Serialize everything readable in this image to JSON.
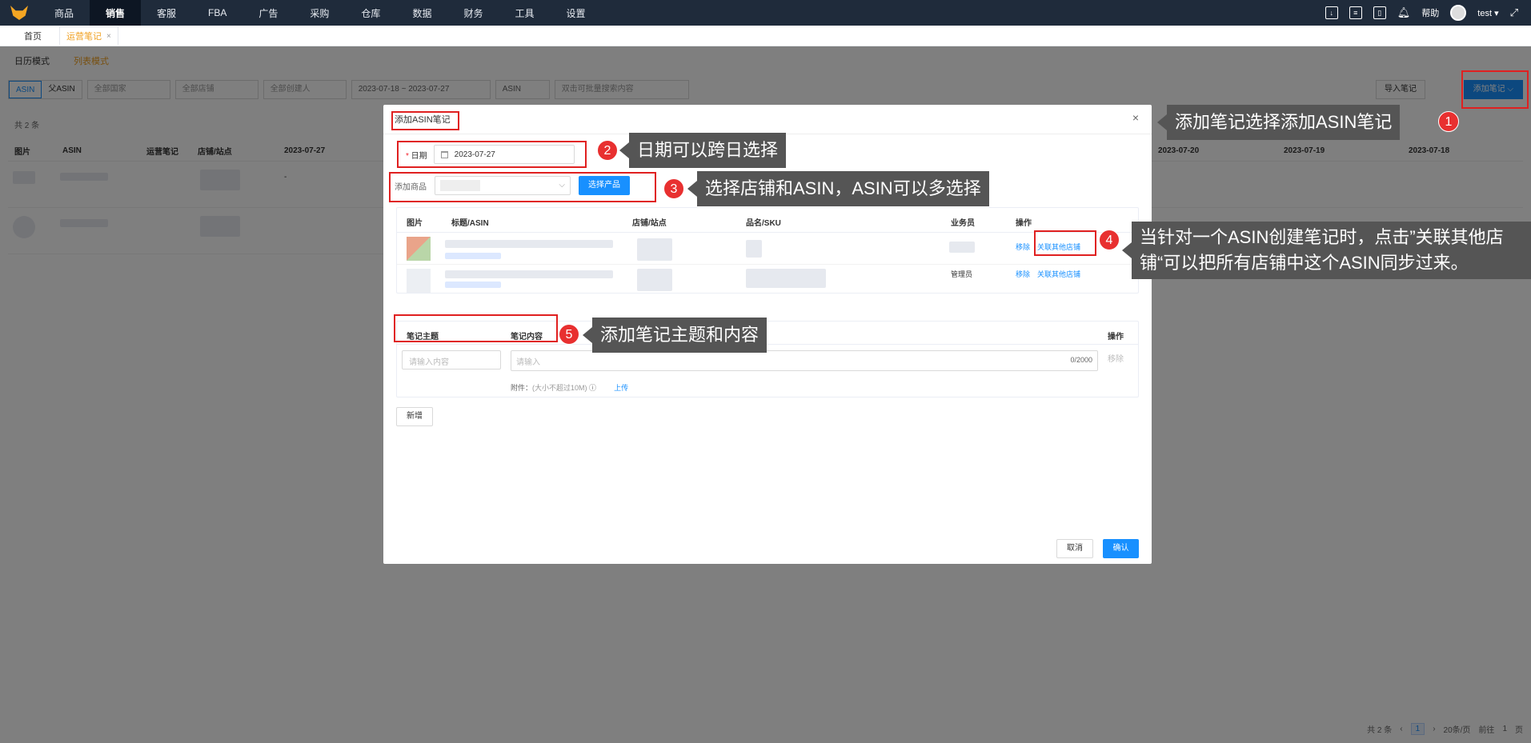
{
  "nav": {
    "items": [
      "商品",
      "销售",
      "客服",
      "FBA",
      "广告",
      "采购",
      "仓库",
      "数据",
      "财务",
      "工具",
      "设置"
    ],
    "active_index": 1,
    "help": "帮助",
    "user": "test ▾"
  },
  "tabs": {
    "home": "首页",
    "notes": "运营笔记"
  },
  "page": {
    "view_tabs": [
      "日历模式",
      "列表模式"
    ],
    "filter_asin": "ASIN",
    "filter_parent_asin": "父ASIN",
    "filter_country": "全部国家",
    "filter_shop": "全部店铺",
    "filter_creator": "全部创建人",
    "date_range": "2023-07-18  ~  2023-07-27",
    "search_type": "ASIN",
    "search_placeholder": "双击可批量搜索内容",
    "import_label": "导入笔记",
    "add_label": "添加笔记 ⌵",
    "count": "共 2 条",
    "columns": [
      "图片",
      "ASIN",
      "运营笔记",
      "店铺/站点",
      "2023-07-27",
      "2023-07-20",
      "2023-07-19",
      "2023-07-18"
    ],
    "row_dash": "-",
    "pager_total": "共 2 条",
    "pager_page": "1",
    "pager_size": "20条/页",
    "pager_goto": "前往",
    "pager_goto_val": "1",
    "pager_page_unit": "页"
  },
  "modal": {
    "title": "添加ASIN笔记",
    "date_label": "日期",
    "date_value": "2023-07-27",
    "product_label": "添加商品",
    "choose_btn": "选择产品",
    "product_cols": [
      "图片",
      "标题/ASIN",
      "店铺/站点",
      "品名/SKU",
      "业务员",
      "操作"
    ],
    "remove": "移除",
    "link_other_shops": "关联其他店铺",
    "manager": "管理员",
    "note_cols": [
      "笔记主题",
      "笔记内容",
      "操作"
    ],
    "subject_placeholder": "请输入内容",
    "content_placeholder": "请输入",
    "content_count": "0/2000",
    "remove_disabled": "移除",
    "attach_label": "附件：",
    "attach_hint": "(大小不超过10M)",
    "upload": "上传",
    "new_btn": "新增",
    "cancel": "取消",
    "confirm": "确认"
  },
  "callouts": {
    "c1": {
      "num": "1",
      "text": "添加笔记选择添加ASIN笔记"
    },
    "c2": {
      "num": "2",
      "text": "日期可以跨日选择"
    },
    "c3": {
      "num": "3",
      "text": "选择店铺和ASIN，ASIN可以多选择"
    },
    "c4": {
      "num": "4",
      "text": "当针对一个ASIN创建笔记时，点击”关联其他店铺“可以把所有店铺中这个ASIN同步过来。"
    },
    "c5": {
      "num": "5",
      "text": "添加笔记主题和内容"
    }
  },
  "colors": {
    "accent": "#1890ff",
    "nav_bg": "#1f2b3b",
    "highlight": "#e02020",
    "badge": "#e83030",
    "active_tab": "#f0a020"
  }
}
